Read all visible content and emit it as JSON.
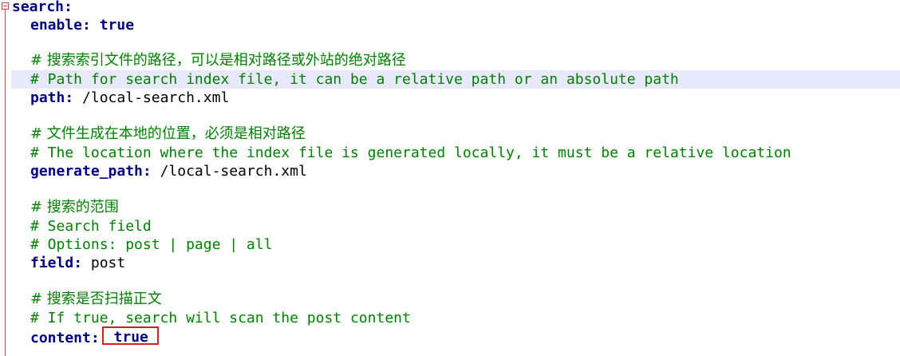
{
  "editor": {
    "lines": [
      {
        "key": "search",
        "sep": ":",
        "value": ""
      },
      {
        "key": "enable",
        "sep": ":",
        "value": "true"
      },
      {
        "comment_cn": "# 搜索索引文件的路径，可以是相对路径或外站的绝对路径"
      },
      {
        "comment": "# Path for search index file, it can be a relative path or an absolute path"
      },
      {
        "key": "path",
        "sep": ":",
        "value": "/local-search.xml"
      },
      {
        "comment_cn": "# 文件生成在本地的位置，必须是相对路径"
      },
      {
        "comment": "# The location where the index file is generated locally, it must be a relative location"
      },
      {
        "key": "generate_path",
        "sep": ":",
        "value": "/local-search.xml"
      },
      {
        "comment_cn": "# 搜索的范围"
      },
      {
        "comment": "# Search field"
      },
      {
        "comment": "# Options: post | page | all"
      },
      {
        "key": "field",
        "sep": ":",
        "value": "post"
      },
      {
        "comment_cn": "# 搜索是否扫描正文"
      },
      {
        "comment": "# If true, search will scan the post content"
      },
      {
        "key": "content",
        "sep": ":",
        "value": "true"
      }
    ]
  },
  "colors": {
    "key": "#000080",
    "comment": "#008000",
    "highlight_line": "#e8e8ff",
    "annotation_box": "#cc2222",
    "fold_marker": "#e04040"
  }
}
